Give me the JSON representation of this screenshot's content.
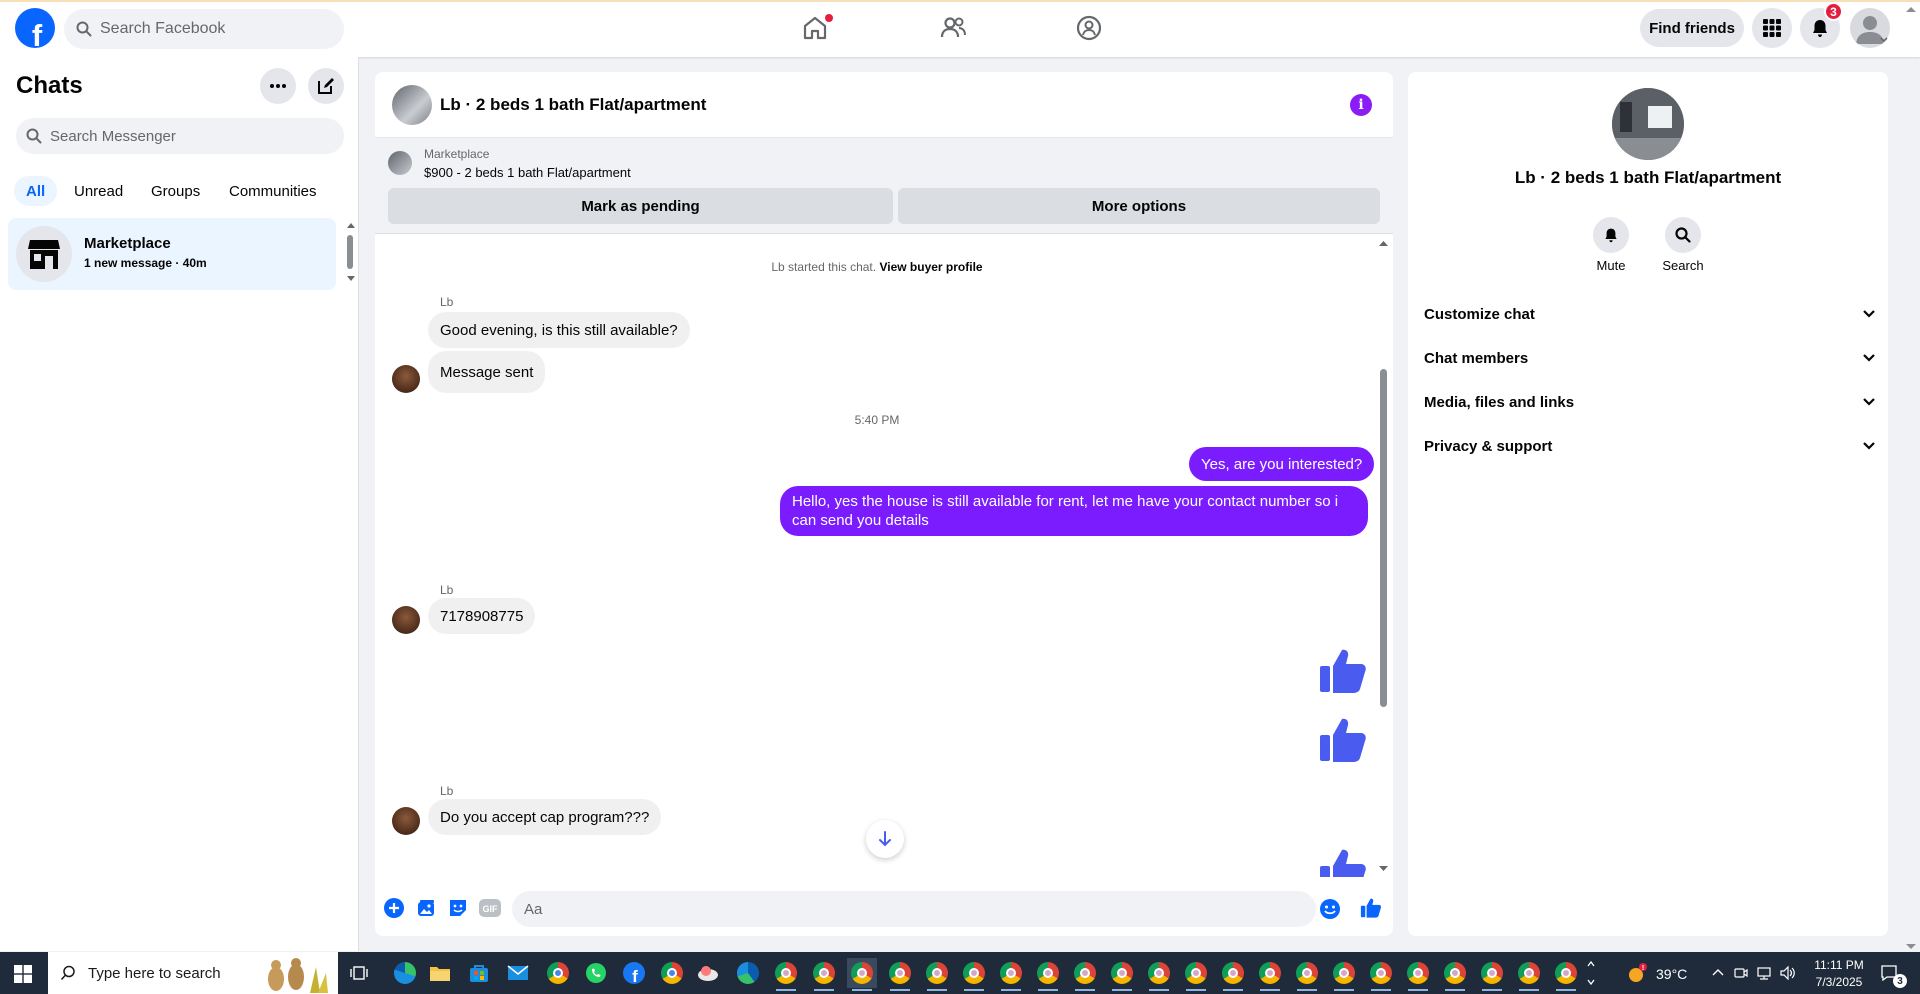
{
  "topbar": {
    "search_placeholder": "Search Facebook",
    "find_friends": "Find friends",
    "notification_count": "3"
  },
  "sidebar": {
    "title": "Chats",
    "search_placeholder": "Search Messenger",
    "filters": [
      "All",
      "Unread",
      "Groups",
      "Communities"
    ],
    "active_filter": "All",
    "conversations": [
      {
        "name": "Marketplace",
        "subtitle": "1 new message · 40m"
      }
    ]
  },
  "chat": {
    "title": "Lb · 2 beds 1 bath Flat/apartment",
    "marketplace_label": "Marketplace",
    "listing": "$900 - 2 beds 1 bath Flat/apartment",
    "mark_pending": "Mark as pending",
    "more_options": "More options",
    "system_text": "Lb started this chat.",
    "system_link": "View buyer profile",
    "time_separator": "5:40 PM",
    "composer_placeholder": "Aa",
    "messages": [
      {
        "sender": "Lb",
        "text": "Good evening, is this still available?"
      },
      {
        "text": "Message sent"
      },
      {
        "text": "Yes, are you interested?"
      },
      {
        "text": "Hello, yes the house is still available for rent, let me have your contact number so i can send you details"
      },
      {
        "sender": "Lb",
        "text": "7178908775"
      },
      {
        "sender": "Lb",
        "text": "Do you accept cap program???"
      }
    ]
  },
  "details": {
    "title": "Lb · 2 beds 1 bath Flat/apartment",
    "mute": "Mute",
    "search": "Search",
    "sections": [
      "Customize chat",
      "Chat members",
      "Media, files and links",
      "Privacy & support"
    ]
  },
  "taskbar": {
    "search_placeholder": "Type here to search",
    "temperature": "39°C",
    "time": "11:11 PM",
    "date": "7/3/2025",
    "notification_count": "3"
  },
  "colors": {
    "accent": "#0866ff",
    "outgoing_bubble": "#7b1cff",
    "like": "#4a5cf0"
  }
}
